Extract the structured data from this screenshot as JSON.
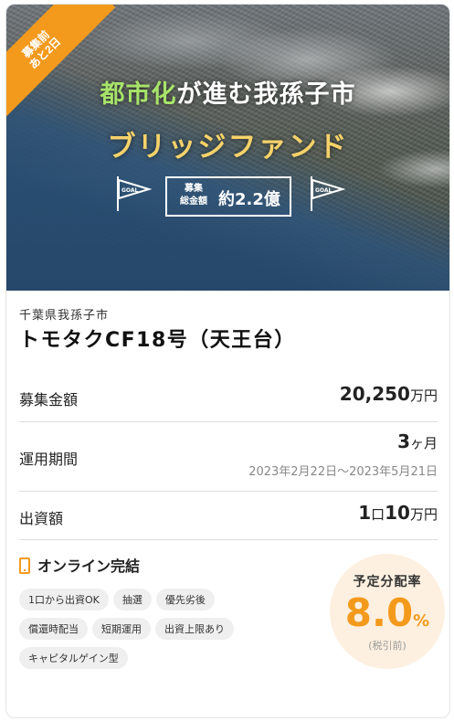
{
  "hero": {
    "ribbon": [
      "募集前",
      "あと2日"
    ],
    "title_line1_green": "都市化",
    "title_line1_rest": "が進む我孫子市",
    "title_line2": "ブリッジファンド",
    "goal_label": "GOAL",
    "amount_small": [
      "募集",
      "総金額"
    ],
    "amount_big": "約2.2億"
  },
  "fund": {
    "prefecture": "千葉県我孫子市",
    "name": "トモタクCF18号（天王台）"
  },
  "details": {
    "amount": {
      "label": "募集金額",
      "value": "20,250",
      "unit": "万円"
    },
    "term": {
      "label": "運用期間",
      "value": "3",
      "unit": "ヶ月",
      "period": "2023年2月22日～2023年5月21日"
    },
    "investment": {
      "label": "出資額",
      "value_a": "1",
      "mid": "口",
      "value_b": "10",
      "unit": "万円"
    }
  },
  "online": {
    "label": "オンライン完結",
    "icon": "smartphone-icon"
  },
  "tags": [
    "1口から出資OK",
    "抽選",
    "優先劣後",
    "償還時配当",
    "短期運用",
    "出資上限あり",
    "キャピタルゲイン型"
  ],
  "rate": {
    "title": "予定分配率",
    "value": "8.0",
    "percent": "%",
    "note": "(税引前)"
  },
  "colors": {
    "accent": "#f39a1c",
    "title_green": "#a8e36a",
    "title_yellow": "#f5d26a"
  }
}
